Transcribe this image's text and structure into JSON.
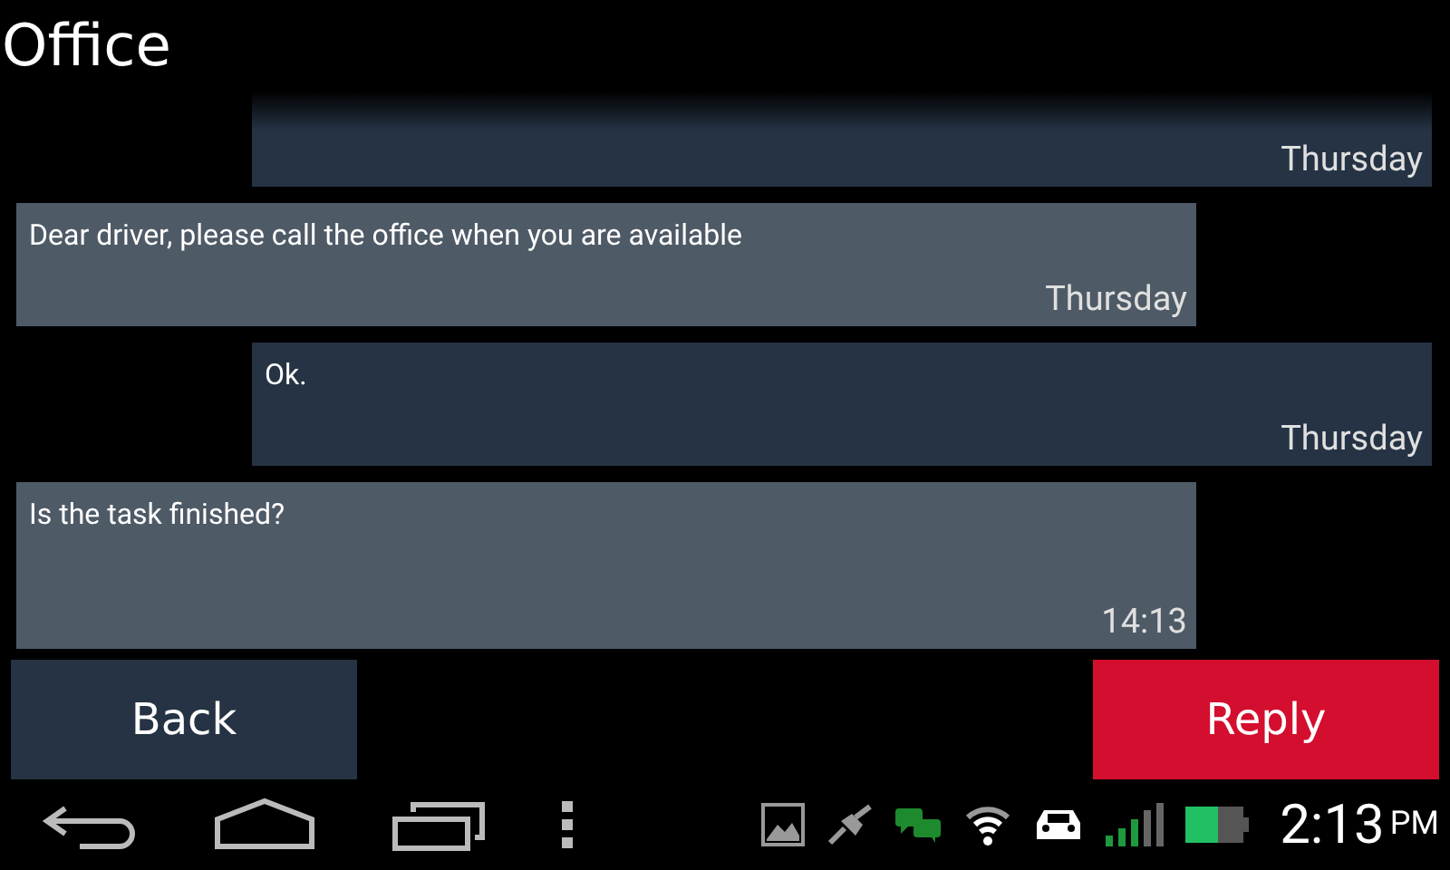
{
  "window": {
    "title": "Office"
  },
  "messages": [
    {
      "kind": "sent",
      "time": "Thursday"
    },
    {
      "kind": "received",
      "text": "Dear driver, please call the office when you are available",
      "time": "Thursday"
    },
    {
      "kind": "sent",
      "text": "Ok.",
      "time": "Thursday"
    },
    {
      "kind": "received",
      "text": "Is the task finished?",
      "time": "14:13"
    }
  ],
  "buttons": [
    {
      "label": "Back",
      "kind": "secondary"
    },
    {
      "label": "Reply",
      "kind": "primary"
    }
  ],
  "status_bar": {
    "time": "2:13",
    "ampm": "PM"
  }
}
